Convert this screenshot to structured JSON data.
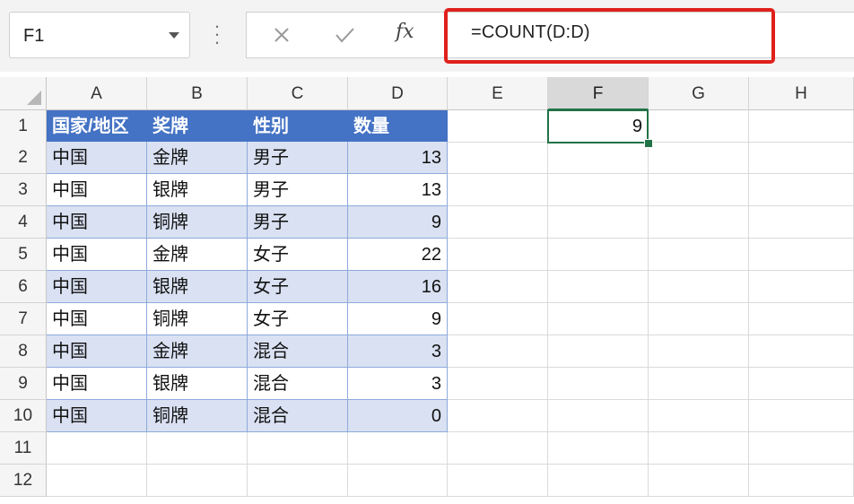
{
  "name_box": {
    "value": "F1"
  },
  "formula_bar": {
    "formula": "=COUNT(D:D)",
    "fx_label": "fx"
  },
  "colors": {
    "header_fill": "#4472c4",
    "band_fill": "#d9e1f2",
    "selection": "#217346",
    "highlight": "#e0201b"
  },
  "columns": [
    "A",
    "B",
    "C",
    "D",
    "E",
    "F",
    "G",
    "H"
  ],
  "selected_column": "F",
  "rows": [
    "1",
    "2",
    "3",
    "4",
    "5",
    "6",
    "7",
    "8",
    "9",
    "10",
    "11",
    "12"
  ],
  "table": {
    "headers": [
      "国家/地区",
      "奖牌",
      "性别",
      "数量"
    ],
    "data": [
      [
        "中国",
        "金牌",
        "男子",
        "13"
      ],
      [
        "中国",
        "银牌",
        "男子",
        "13"
      ],
      [
        "中国",
        "铜牌",
        "男子",
        "9"
      ],
      [
        "中国",
        "金牌",
        "女子",
        "22"
      ],
      [
        "中国",
        "银牌",
        "女子",
        "16"
      ],
      [
        "中国",
        "铜牌",
        "女子",
        "9"
      ],
      [
        "中国",
        "金牌",
        "混合",
        "3"
      ],
      [
        "中国",
        "银牌",
        "混合",
        "3"
      ],
      [
        "中国",
        "铜牌",
        "混合",
        "0"
      ]
    ]
  },
  "result_cell": {
    "ref": "F1",
    "value": "9"
  }
}
